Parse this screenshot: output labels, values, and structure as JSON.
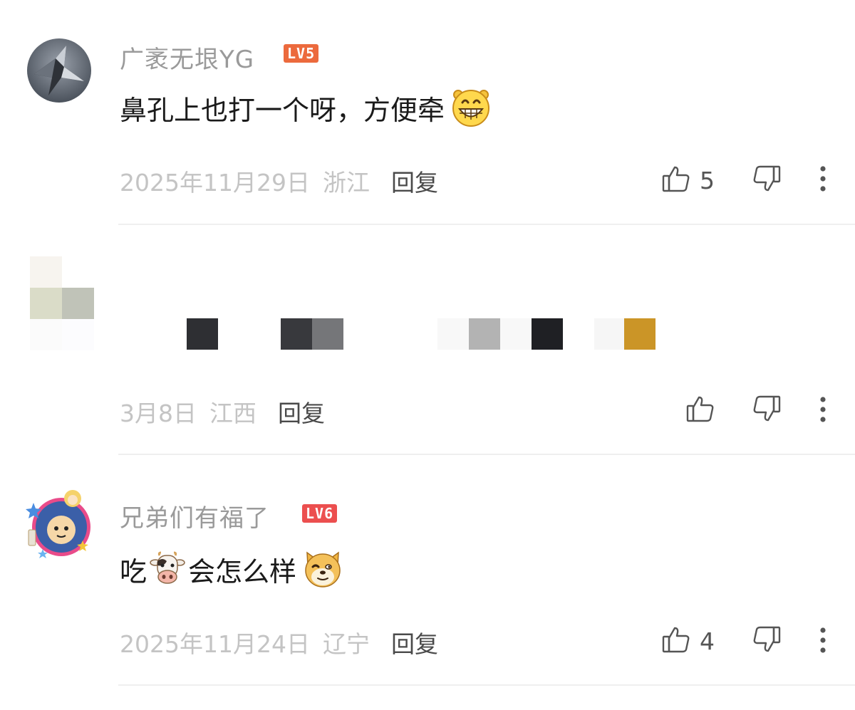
{
  "comments": [
    {
      "username": "广袤无垠YG",
      "level": "LV5",
      "level_color": "#ec6a3d",
      "text": "鼻孔上也打一个呀，方便牵",
      "emoji": "grinning-face-emoji",
      "date": "2025年11月29日",
      "location": "浙江",
      "reply": "回复",
      "likes": "5"
    },
    {
      "date": "3月8日",
      "location": "江西",
      "reply": "回复"
    },
    {
      "username": "兄弟们有福了",
      "level": "LV6",
      "level_color": "#ec4f4f",
      "text_before": "吃",
      "inline_emoji": "cow-face-emoji",
      "text_after": "会怎么样",
      "emoji": "doge-face-emoji",
      "date": "2025年11月24日",
      "location": "辽宁",
      "reply": "回复",
      "likes": "4"
    }
  ]
}
